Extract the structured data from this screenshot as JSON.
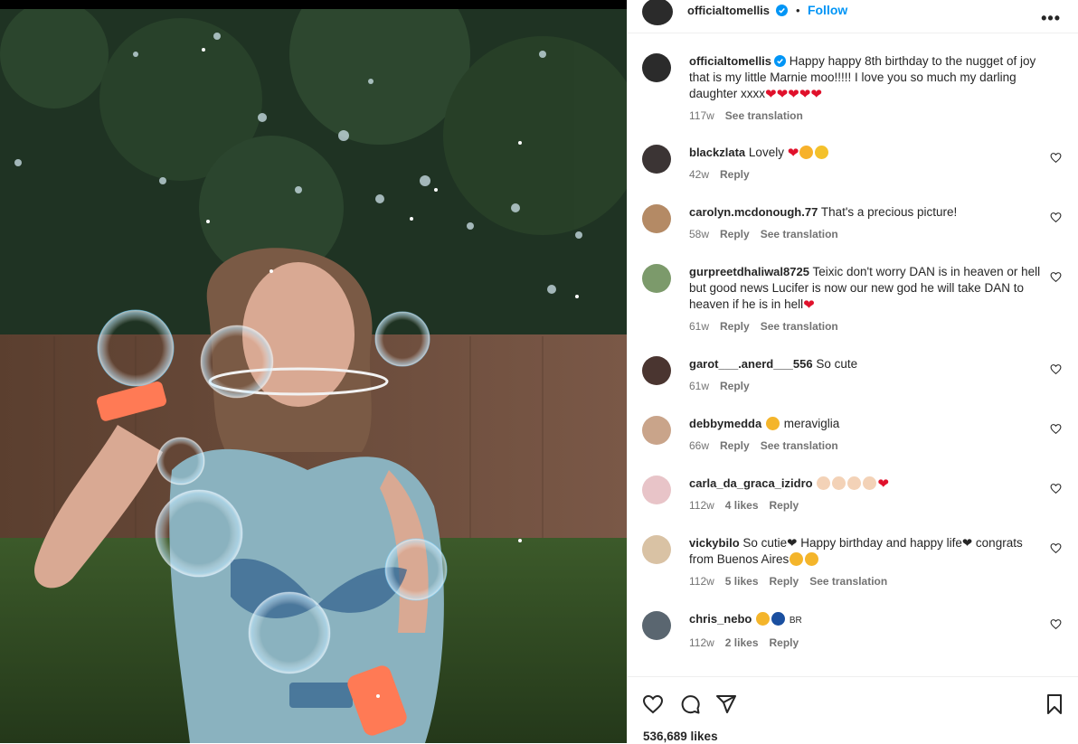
{
  "post": {
    "username": "officialtomellis",
    "follow_label": "Follow",
    "more_label": "•••",
    "caption": {
      "username": "officialtomellis",
      "text": "Happy happy 8th birthday to the nugget of joy that is my little Marnie moo!!!!! I love you so much my darling daughter xxxx",
      "emoji": "❤❤❤❤❤",
      "time": "117w",
      "translate": "See translation"
    },
    "likes": "536,689 likes"
  },
  "comments": [
    {
      "user": "blackzlata",
      "text": "Lovely",
      "emoji": "❤",
      "time": "42w",
      "likes": "",
      "reply": "Reply",
      "translate": ""
    },
    {
      "user": "carolyn.mcdonough.77",
      "text": "That's a precious picture!",
      "emoji": "",
      "time": "58w",
      "likes": "",
      "reply": "Reply",
      "translate": "See translation"
    },
    {
      "user": "gurpreetdhaliwal8725",
      "text": "Teixic don't worry DAN is in heaven or hell but good news Lucifer is now our new god he will take DAN to heaven if he is in hell",
      "emoji": "❤",
      "time": "61w",
      "likes": "",
      "reply": "Reply",
      "translate": "See translation"
    },
    {
      "user": "garot___.anerd___556",
      "text": "So cute",
      "emoji": "",
      "time": "61w",
      "likes": "",
      "reply": "Reply",
      "translate": ""
    },
    {
      "user": "debbymedda",
      "text": "meraviglia",
      "emoji": "",
      "time": "66w",
      "likes": "",
      "reply": "Reply",
      "translate": "See translation"
    },
    {
      "user": "carla_da_graca_izidro",
      "text": "",
      "emoji": "❤",
      "time": "112w",
      "likes": "4 likes",
      "reply": "Reply",
      "translate": ""
    },
    {
      "user": "vickybilo",
      "text": "So cutie❤ Happy birthday and happy life❤ congrats from Buenos Aires",
      "emoji": "",
      "time": "112w",
      "likes": "5 likes",
      "reply": "Reply",
      "translate": "See translation"
    },
    {
      "user": "chris_nebo",
      "text": "BR",
      "emoji": "",
      "time": "112w",
      "likes": "2 likes",
      "reply": "Reply",
      "translate": ""
    }
  ],
  "colors": {
    "accent": "#0095f6",
    "heart": "#e0112b",
    "text": "#262626",
    "muted": "#737373"
  },
  "icons": [
    "verified-badge-icon",
    "heart-icon",
    "comment-icon",
    "share-icon",
    "save-icon",
    "more-icon"
  ]
}
